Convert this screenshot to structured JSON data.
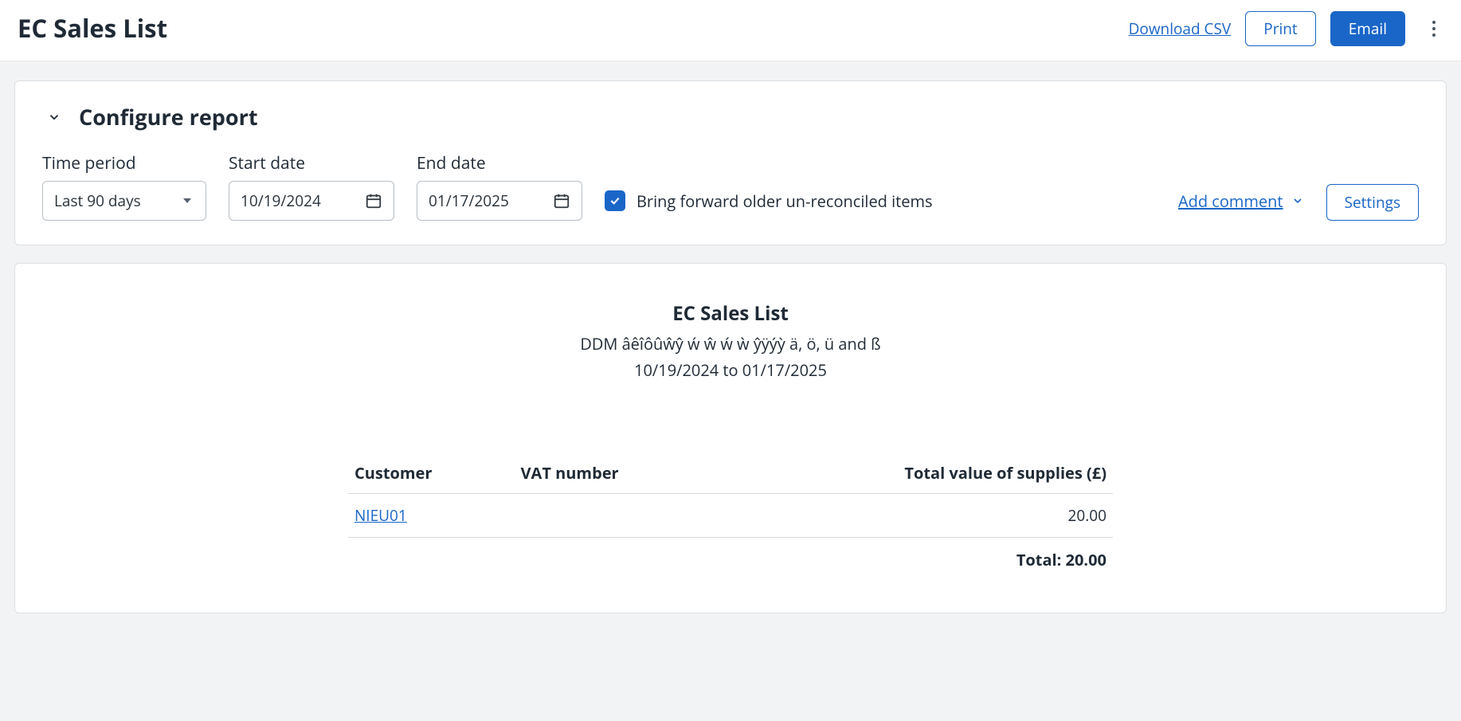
{
  "header": {
    "title": "EC Sales List",
    "download_csv": "Download CSV",
    "print": "Print",
    "email": "Email"
  },
  "config": {
    "section_title": "Configure report",
    "time_period_label": "Time period",
    "time_period_value": "Last 90 days",
    "start_date_label": "Start date",
    "start_date_value": "10/19/2024",
    "end_date_label": "End date",
    "end_date_value": "01/17/2025",
    "bring_forward_label": "Bring forward older un-reconciled items",
    "bring_forward_checked": true,
    "add_comment": "Add comment",
    "settings": "Settings"
  },
  "report": {
    "title": "EC Sales List",
    "subtitle": "DDM âêîôûŵŷ ẃ ŵ ẃ ẁ ŷÿýỳ ä, ö, ü and ß",
    "date_range": "10/19/2024 to 01/17/2025",
    "columns": {
      "customer": "Customer",
      "vat": "VAT number",
      "total": "Total value of supplies (£)"
    },
    "rows": [
      {
        "customer": "NIEU01",
        "vat": "",
        "total": "20.00"
      }
    ],
    "total_label": "Total: 20.00"
  }
}
